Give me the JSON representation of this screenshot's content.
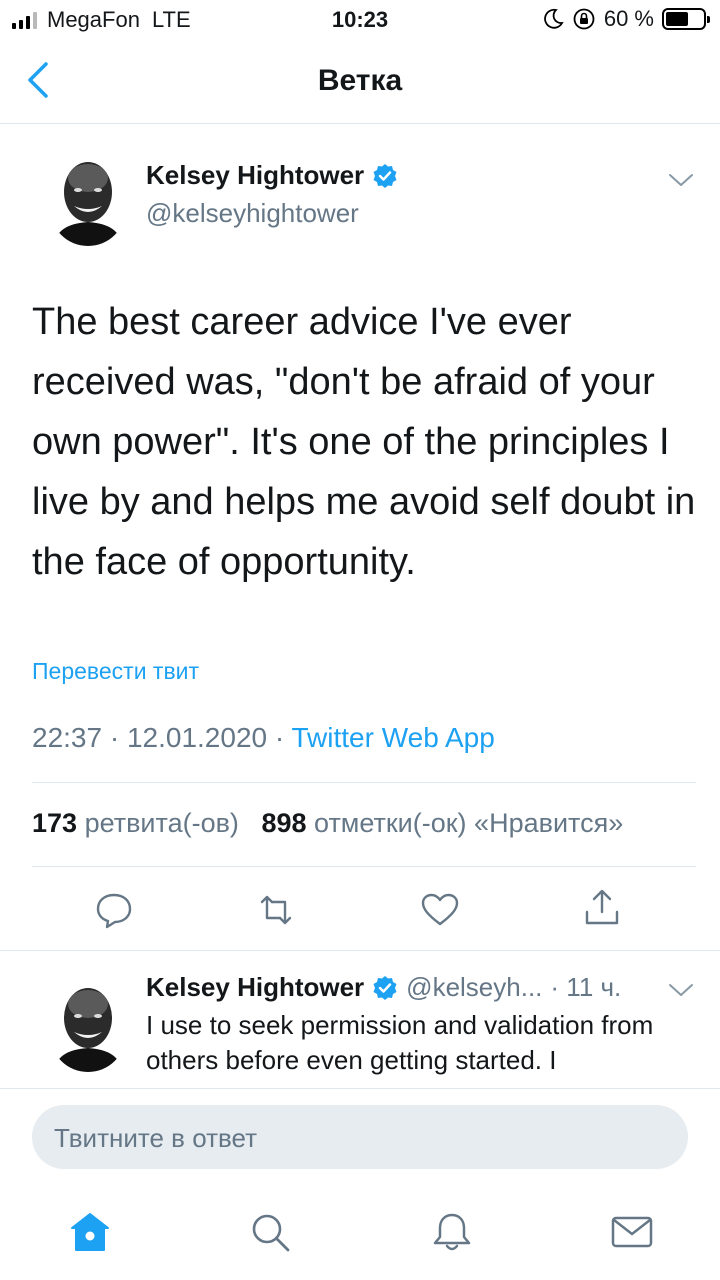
{
  "status_bar": {
    "carrier": "MegaFon",
    "network": "LTE",
    "time": "10:23",
    "battery": "60 %",
    "battery_level_percent": 60
  },
  "nav": {
    "back_icon": "chevron-left-icon",
    "title": "Ветка"
  },
  "tweet": {
    "author_name": "Kelsey Hightower",
    "author_handle": "@kelseyhightower",
    "text": "The best career advice I've ever received was, \"don't be afraid of your own power\". It's one of the principles I live by and helps me avoid self doubt in the face of opportunity.",
    "translate_label": "Перевести твит",
    "timestamp": "22:37 · 12.01.2020 · ",
    "source": "Twitter Web App",
    "retweets_count": "173",
    "retweets_label": "ретвита(-ов)",
    "likes_count": "898",
    "likes_label": "отметки(-ок) «Нравится»"
  },
  "reply": {
    "author_name": "Kelsey Hightower",
    "author_handle": "@kelseyh...",
    "time": "· 11 ч.",
    "text": "I use to seek permission and validation from others before even getting started. I"
  },
  "composer": {
    "placeholder": "Твитните в ответ"
  },
  "tabbar": {
    "items": [
      "home-icon",
      "search-icon",
      "notifications-icon",
      "messages-icon"
    ]
  },
  "colors": {
    "accent": "#1da1f2",
    "secondary_text": "#657786",
    "divider": "#e1e8ed"
  }
}
